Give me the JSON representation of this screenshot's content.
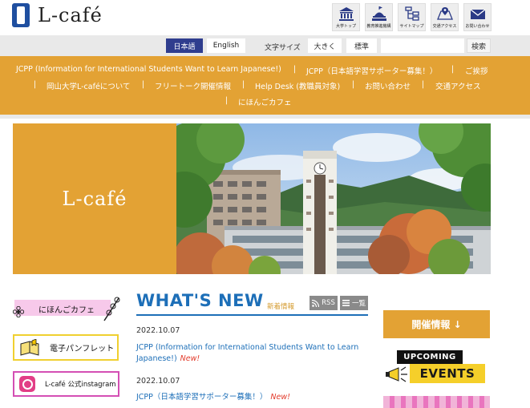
{
  "header": {
    "logo_text": "L-café",
    "icon_nav": [
      {
        "label": "大学トップ",
        "icon": "university-building-icon"
      },
      {
        "label": "教育推進機構",
        "icon": "institution-dome-icon"
      },
      {
        "label": "サイトマップ",
        "icon": "sitemap-icon"
      },
      {
        "label": "交通アクセス",
        "icon": "map-icon"
      },
      {
        "label": "お問い合わせ",
        "icon": "mail-icon"
      }
    ]
  },
  "utility_bar": {
    "lang_ja": "日本語",
    "lang_en": "English",
    "font_size_label": "文字サイズ",
    "font_large": "大きく",
    "font_standard": "標準",
    "search_placeholder": "",
    "search_button": "検索"
  },
  "global_nav": {
    "items": [
      "JCPP (Information for International Students Want to Learn Japanese!)",
      "JCPP（日本語学習サポーター募集！）",
      "ご挨拶",
      "岡山大学L-caféについて",
      "フリートーク開催情報",
      "Help Desk (教職員対象)",
      "お問い合わせ",
      "交通アクセス",
      "にほんごカフェ"
    ],
    "separator": "|"
  },
  "hero": {
    "title": "L-café"
  },
  "sidebar": {
    "nihongo_cafe": "にほんごカフェ",
    "pamphlet": "電子パンフレット",
    "instagram": "L-café 公式instagram"
  },
  "whats_new": {
    "title": "WHAT'S NEW",
    "subtitle": "新着情報",
    "rss_label": "RSS",
    "list_label": "一覧",
    "news": [
      {
        "date": "2022.10.07",
        "title": "JCPP (Information for International Students Want to Learn Japanese!)",
        "badge": "New!"
      },
      {
        "date": "2022.10.07",
        "title": "JCPP（日本語学習サポーター募集！）",
        "badge": "New!"
      }
    ]
  },
  "right_column": {
    "event_info_button": "開催情報 ↓",
    "upcoming": "UPCOMING",
    "events": "EVENTS"
  },
  "colors": {
    "accent_orange": "#e3a234",
    "brand_blue": "#1d6fb8",
    "lang_active": "#2f3d8e",
    "new_badge": "#e23a2a"
  }
}
